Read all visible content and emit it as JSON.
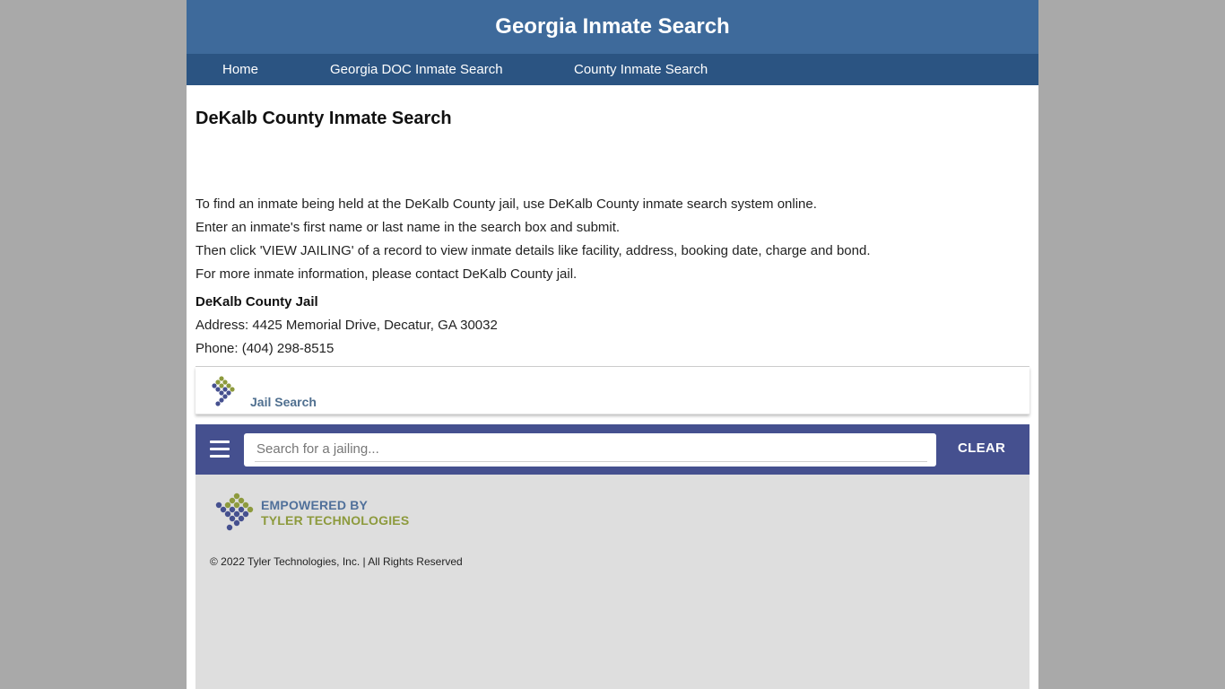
{
  "header": {
    "title": "Georgia Inmate Search"
  },
  "nav": {
    "home": "Home",
    "doc_search": "Georgia DOC Inmate Search",
    "county_search": "County Inmate Search"
  },
  "main": {
    "title": "DeKalb County Inmate Search",
    "paragraphs": [
      "To find an inmate being held at the DeKalb County jail, use DeKalb County inmate search system online.",
      "Enter an inmate's first name or last name in the search box and submit.",
      "Then click 'VIEW JAILING' of a record to view inmate details like facility, address, booking date, charge and bond.",
      "For more inmate information, please contact DeKalb County jail."
    ],
    "jail": {
      "name": "DeKalb County Jail",
      "address": "Address: 4425 Memorial Drive, Decatur, GA 30032",
      "phone": "Phone: (404) 298-8515"
    }
  },
  "widget": {
    "brand_label": "Jail Search",
    "menu_icon": "hamburger-menu-icon",
    "search_placeholder": "Search for a jailing...",
    "search_value": "",
    "clear_label": "CLEAR",
    "powered_line1": "EMPOWERED BY",
    "powered_line2": "TYLER TECHNOLOGIES",
    "copyright": "© 2022 Tyler Technologies, Inc. | All Rights Reserved"
  },
  "colors": {
    "page_bg": "#a9a9a9",
    "header": "#3e6a9b",
    "nav": "#2b5482",
    "search_bar": "#45508f",
    "footer": "#dedede",
    "logo_blue": "#45508f",
    "logo_olive": "#8d9a3d"
  }
}
